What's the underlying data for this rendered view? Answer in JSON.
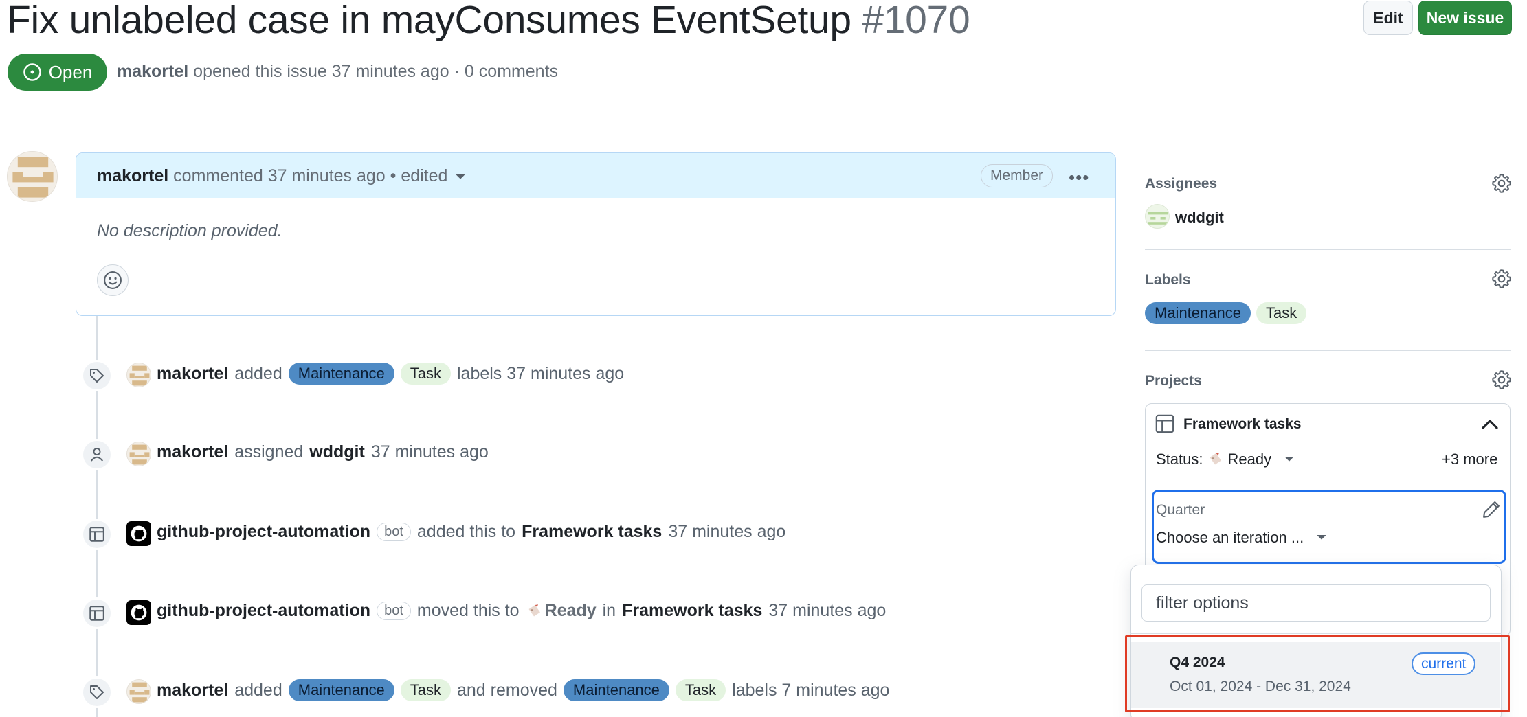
{
  "issue": {
    "title": "Fix unlabeled case in mayConsumes EventSetup",
    "number": "#1070",
    "state": "Open",
    "author": "makortel",
    "opened_text": "opened this issue 37 minutes ago · 0 comments"
  },
  "header_buttons": {
    "edit": "Edit",
    "new_issue": "New issue"
  },
  "comment": {
    "author": "makortel",
    "meta": "commented 37 minutes ago • edited",
    "role_badge": "Member",
    "body": "No description provided."
  },
  "timeline": [
    {
      "actor": "makortel",
      "action": "added",
      "labels": [
        "Maintenance",
        "Task"
      ],
      "tail": "labels 37 minutes ago"
    },
    {
      "actor": "makortel",
      "action": "assigned",
      "target": "wddgit",
      "tail": "37 minutes ago"
    },
    {
      "actor": "github-project-automation",
      "badge": "bot",
      "action": "added this to",
      "target": "Framework tasks",
      "tail": "37 minutes ago"
    },
    {
      "actor": "github-project-automation",
      "badge": "bot",
      "action": "moved this to",
      "status": "Ready",
      "connector": "in",
      "target": "Framework tasks",
      "tail": "37 minutes ago"
    },
    {
      "actor": "makortel",
      "action": "added",
      "labels": [
        "Maintenance",
        "Task"
      ],
      "middle": "and removed",
      "removed_labels": [
        "Maintenance",
        "Task"
      ],
      "tail": "labels 7 minutes ago"
    }
  ],
  "sidebar": {
    "assignees_heading": "Assignees",
    "assignee": "wddgit",
    "labels_heading": "Labels",
    "labels": [
      "Maintenance",
      "Task"
    ],
    "projects_heading": "Projects",
    "project": {
      "name": "Framework tasks",
      "status_label": "Status:",
      "status_value": "Ready",
      "more": "+3 more",
      "quarter_label": "Quarter",
      "quarter_value": "Choose an iteration ..."
    },
    "dropdown": {
      "filter_placeholder": "filter options",
      "option_title": "Q4 2024",
      "option_dates": "Oct 01, 2024 - Dec 31, 2024",
      "option_badge": "current"
    }
  },
  "colors": {
    "open_green": "#2c8a3f",
    "maintenance_label": "#4e8ac4",
    "task_label": "#e4f4e0",
    "focus_blue": "#1f6feb",
    "highlight_red": "#e03b24"
  }
}
